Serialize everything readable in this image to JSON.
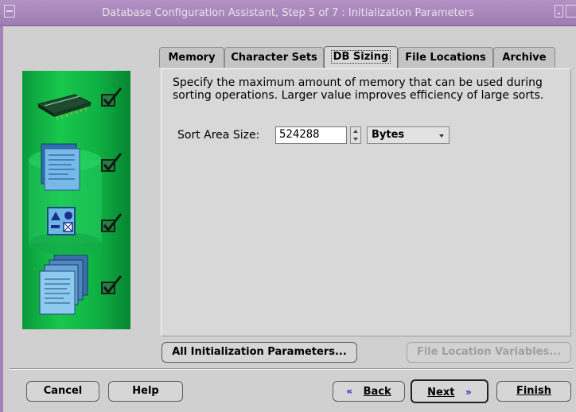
{
  "window": {
    "title": "Database Configuration Assistant, Step 5 of 7 : Initialization Parameters"
  },
  "tabs": [
    {
      "label": "Memory",
      "active": false
    },
    {
      "label": "Character Sets",
      "active": false
    },
    {
      "label": "DB Sizing",
      "active": true
    },
    {
      "label": "File Locations",
      "active": false
    },
    {
      "label": "Archive",
      "active": false
    }
  ],
  "db_sizing": {
    "description": "Specify the maximum amount of memory that can be used during sorting operations. Larger value improves efficiency of large sorts.",
    "sort_area_label": "Sort Area Size:",
    "sort_area_value": "524288",
    "unit_selected": "Bytes"
  },
  "buttons": {
    "all_params": "All Initialization Parameters...",
    "file_location_vars": "File Location Variables...",
    "cancel": "Cancel",
    "help": "Help",
    "back": "Back",
    "next": "Next",
    "finish": "Finish"
  },
  "icons": {
    "art_steps": [
      "memory-chip-icon",
      "database-documents-icon",
      "shapes-icon",
      "stacked-documents-icon"
    ],
    "check": "checkbox-checked-icon"
  },
  "colors": {
    "titlebar": "#a887b9",
    "art_green": "#18c84e",
    "accent_blue": "#1d2dbb"
  }
}
